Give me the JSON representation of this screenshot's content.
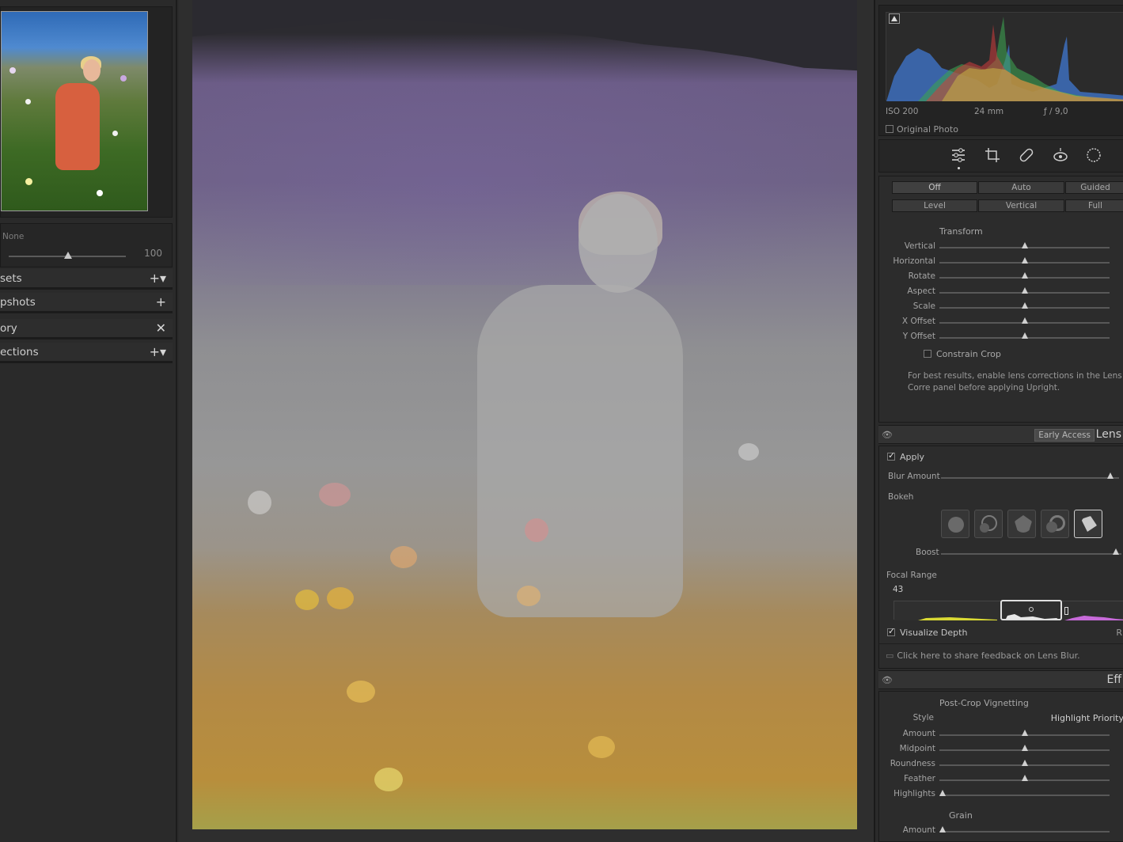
{
  "left_panel": {
    "zoom": {
      "label": "None",
      "value": "100"
    },
    "sections": [
      {
        "label": "sets",
        "action": "+▾"
      },
      {
        "label": "pshots",
        "action": "+"
      },
      {
        "label": "ory",
        "action": "✕"
      },
      {
        "label": "ections",
        "action": "+▾"
      }
    ]
  },
  "histogram": {
    "iso": "ISO 200",
    "focal": "24 mm",
    "aperture": "ƒ / 9,0",
    "original_photo": "Original Photo"
  },
  "upright": {
    "row1": [
      "Off",
      "Auto",
      "Guided"
    ],
    "row2": [
      "Level",
      "Vertical",
      "Full"
    ],
    "transform_title": "Transform",
    "sliders": [
      {
        "label": "Vertical",
        "value": 0.5
      },
      {
        "label": "Horizontal",
        "value": 0.5
      },
      {
        "label": "Rotate",
        "value": 0.5
      },
      {
        "label": "Aspect",
        "value": 0.5
      },
      {
        "label": "Scale",
        "value": 0.5
      },
      {
        "label": "X Offset",
        "value": 0.5
      },
      {
        "label": "Y Offset",
        "value": 0.5
      }
    ],
    "constrain_crop": "Constrain Crop",
    "hint": "For best results, enable lens corrections in the Lens Corre panel before applying Upright."
  },
  "lens_blur": {
    "badge": "Early Access",
    "title": "Lens",
    "apply": "Apply",
    "blur_amount_label": "Blur Amount",
    "blur_amount": 0.95,
    "bokeh_label": "Bokeh",
    "boost_label": "Boost",
    "boost": 0.97,
    "focal_range_label": "Focal Range",
    "focal_range_value": "43",
    "visualize_depth": "Visualize Depth",
    "visualize_right": "R",
    "feedback": "Click here to share feedback on Lens Blur."
  },
  "effects": {
    "title": "Eff",
    "vignette_title": "Post-Crop Vignetting",
    "style_label": "Style",
    "style_value": "Highlight Priority",
    "sliders": [
      {
        "label": "Amount",
        "value": 0.5
      },
      {
        "label": "Midpoint",
        "value": 0.5
      },
      {
        "label": "Roundness",
        "value": 0.5
      },
      {
        "label": "Feather",
        "value": 0.5
      },
      {
        "label": "Highlights",
        "value": 0.02
      }
    ],
    "grain_title": "Grain",
    "grain_amount_label": "Amount",
    "grain_amount": 0.02
  }
}
